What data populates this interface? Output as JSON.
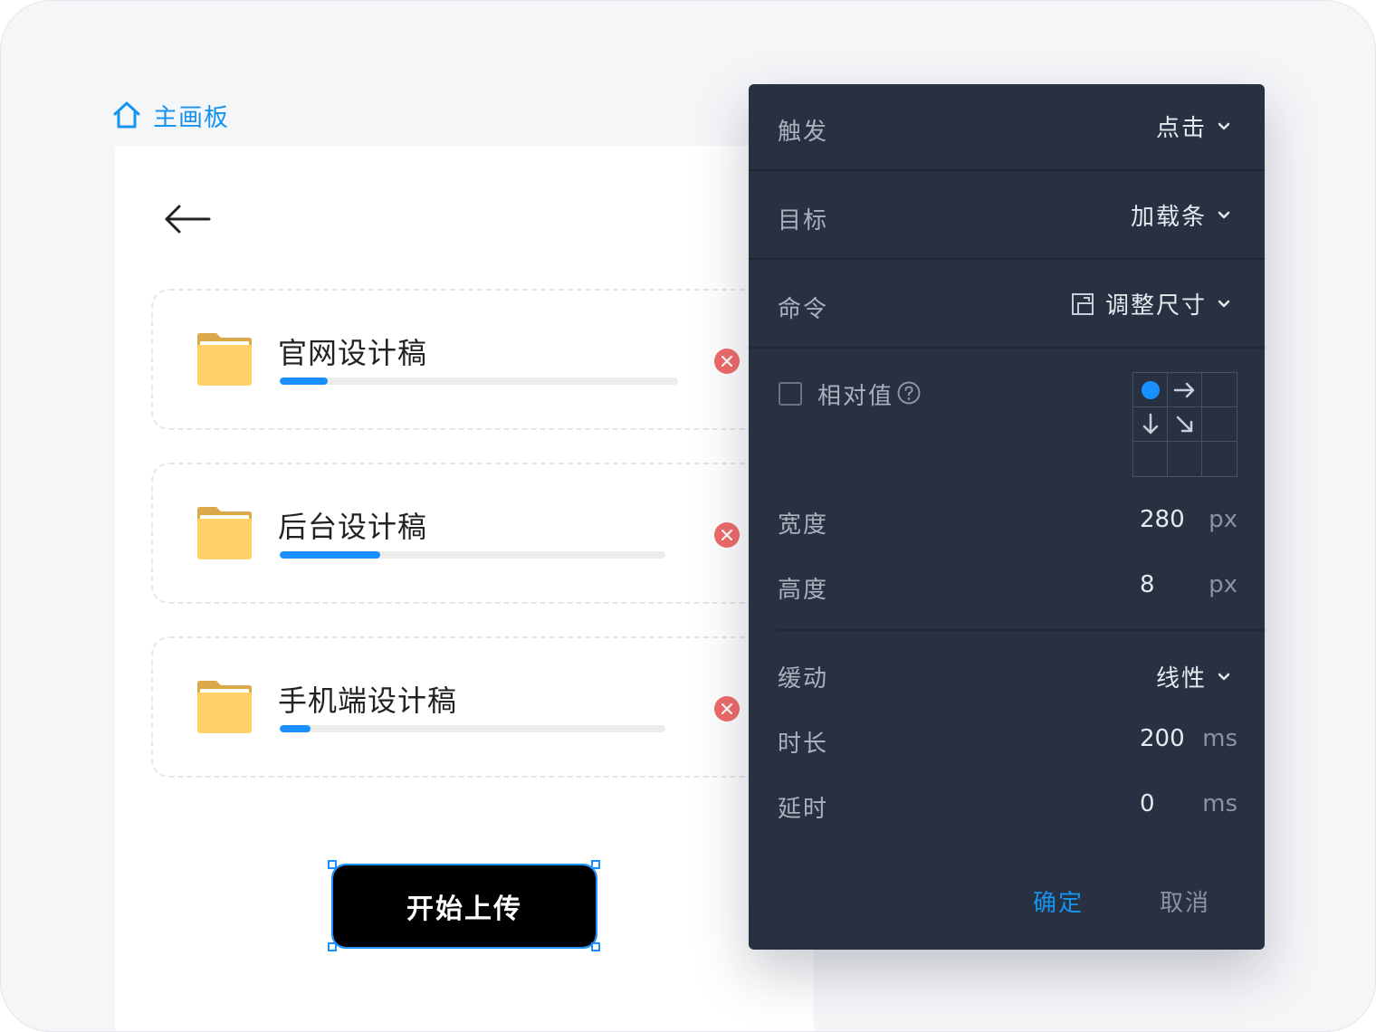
{
  "breadcrumb": {
    "icon": "home-icon",
    "label": "主画板",
    "color": "#1694f0"
  },
  "files": [
    {
      "name": "官网设计稿",
      "progress": 0.12
    },
    {
      "name": "后台设计稿",
      "progress": 0.26
    },
    {
      "name": "手机端设计稿",
      "progress": 0.08
    }
  ],
  "start_button": {
    "label": "开始上传"
  },
  "panel": {
    "trigger": {
      "label": "触发",
      "value": "点击"
    },
    "target": {
      "label": "目标",
      "value": "加载条"
    },
    "command": {
      "label": "命令",
      "value": "调整尺寸",
      "icon": "resize-icon"
    },
    "relative": {
      "label": "相对值",
      "checked": false
    },
    "anchor": {
      "selected": "top-left"
    },
    "width": {
      "label": "宽度",
      "value": "280",
      "unit": "px"
    },
    "height": {
      "label": "高度",
      "value": "8",
      "unit": "px"
    },
    "easing": {
      "label": "缓动",
      "value": "线性"
    },
    "duration": {
      "label": "时长",
      "value": "200",
      "unit": "ms"
    },
    "delay": {
      "label": "延时",
      "value": "0",
      "unit": "ms"
    },
    "confirm": "确定",
    "cancel": "取消"
  },
  "colors": {
    "accent": "#1890ff",
    "danger": "#f06b6b",
    "panel_bg": "#283142",
    "folder": "#ffd166"
  }
}
